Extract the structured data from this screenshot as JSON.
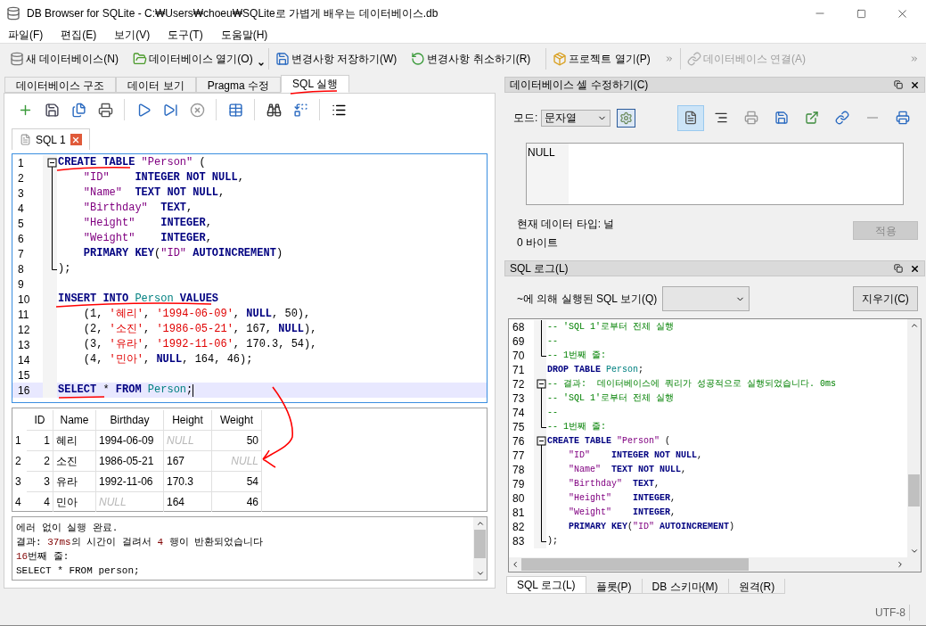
{
  "window": {
    "title": "DB Browser for SQLite - C:₩Users₩choeu₩SQLite로 가볍게 배우는 데이터베이스.db"
  },
  "menu": [
    "파일(F)",
    "편집(E)",
    "보기(V)",
    "도구(T)",
    "도움말(H)"
  ],
  "toolbar": [
    {
      "label": "새 데이터베이스(N)",
      "kind": "new",
      "disabled": false
    },
    {
      "label": "데이터베이스 열기(O)",
      "kind": "open",
      "disabled": false
    },
    {
      "label": "변경사항 저장하기(W)",
      "kind": "save",
      "disabled": false
    },
    {
      "label": "변경사항 취소하기(R)",
      "kind": "revert",
      "disabled": false
    },
    {
      "label": "프로젝트 열기(P)",
      "kind": "project",
      "disabled": false
    },
    {
      "label": "데이터베이스 연결(A)",
      "kind": "attach",
      "disabled": true
    }
  ],
  "tabs": [
    {
      "label": "데이터베이스 구조",
      "selected": false
    },
    {
      "label": "데이터 보기",
      "selected": false
    },
    {
      "label": "Pragma 수정",
      "selected": false
    },
    {
      "label": "SQL 실행",
      "selected": true
    }
  ],
  "editor": {
    "tab": "SQL 1",
    "lines": [
      {
        "number": "1",
        "kind": "fold_start",
        "current": false,
        "tokens": [
          {
            "kind": "keyword",
            "text": "CREATE TABLE"
          },
          {
            "kind": "string",
            "text": " \"Person\""
          },
          {
            "kind": "plain",
            "text": " ("
          }
        ]
      },
      {
        "number": "2",
        "kind": "fold_body",
        "current": false,
        "tokens": [
          {
            "kind": "string",
            "text": "    \"ID\""
          },
          {
            "kind": "keyword",
            "text": "    INTEGER NOT NULL"
          },
          {
            "kind": "plain",
            "text": ","
          }
        ]
      },
      {
        "number": "3",
        "kind": "fold_body",
        "current": false,
        "tokens": [
          {
            "kind": "string",
            "text": "    \"Name\""
          },
          {
            "kind": "keyword",
            "text": "  TEXT NOT NULL"
          },
          {
            "kind": "plain",
            "text": ","
          }
        ]
      },
      {
        "number": "4",
        "kind": "fold_body",
        "current": false,
        "tokens": [
          {
            "kind": "string",
            "text": "    \"Birthday\""
          },
          {
            "kind": "keyword",
            "text": "  TEXT"
          },
          {
            "kind": "plain",
            "text": ","
          }
        ]
      },
      {
        "number": "5",
        "kind": "fold_body",
        "current": false,
        "tokens": [
          {
            "kind": "string",
            "text": "    \"Height\""
          },
          {
            "kind": "keyword",
            "text": "    INTEGER"
          },
          {
            "kind": "plain",
            "text": ","
          }
        ]
      },
      {
        "number": "6",
        "kind": "fold_body",
        "current": false,
        "tokens": [
          {
            "kind": "string",
            "text": "    \"Weight\""
          },
          {
            "kind": "keyword",
            "text": "    INTEGER"
          },
          {
            "kind": "plain",
            "text": ","
          }
        ]
      },
      {
        "number": "7",
        "kind": "fold_body",
        "current": false,
        "tokens": [
          {
            "kind": "keyword",
            "text": "    PRIMARY KEY"
          },
          {
            "kind": "plain",
            "text": "("
          },
          {
            "kind": "string",
            "text": "\"ID\""
          },
          {
            "kind": "keyword",
            "text": " AUTOINCREMENT"
          },
          {
            "kind": "plain",
            "text": ")"
          }
        ]
      },
      {
        "number": "8",
        "kind": "fold_end",
        "current": false,
        "tokens": [
          {
            "kind": "plain",
            "text": ");"
          }
        ]
      },
      {
        "number": "9",
        "kind": "code",
        "current": false
      },
      {
        "number": "10",
        "kind": "code",
        "current": false,
        "tokens": [
          {
            "kind": "keyword",
            "text": "INSERT INTO"
          },
          {
            "kind": "identifier",
            "text": " Person"
          },
          {
            "kind": "keyword",
            "text": " VALUES"
          }
        ]
      },
      {
        "number": "11",
        "kind": "code",
        "current": false,
        "tokens": [
          {
            "kind": "plain",
            "text": "    (1, "
          },
          {
            "kind": "literal",
            "text": "'혜리'"
          },
          {
            "kind": "plain",
            "text": ", "
          },
          {
            "kind": "literal",
            "text": "'1994-06-09'"
          },
          {
            "kind": "plain",
            "text": ", "
          },
          {
            "kind": "keyword",
            "text": "NULL"
          },
          {
            "kind": "plain",
            "text": ", 50),"
          }
        ]
      },
      {
        "number": "12",
        "kind": "code",
        "current": false,
        "tokens": [
          {
            "kind": "plain",
            "text": "    (2, "
          },
          {
            "kind": "literal",
            "text": "'소진'"
          },
          {
            "kind": "plain",
            "text": ", "
          },
          {
            "kind": "literal",
            "text": "'1986-05-21'"
          },
          {
            "kind": "plain",
            "text": ", 167, "
          },
          {
            "kind": "keyword",
            "text": "NULL"
          },
          {
            "kind": "plain",
            "text": "),"
          }
        ]
      },
      {
        "number": "13",
        "kind": "code",
        "current": false,
        "tokens": [
          {
            "kind": "plain",
            "text": "    (3, "
          },
          {
            "kind": "literal",
            "text": "'유라'"
          },
          {
            "kind": "plain",
            "text": ", "
          },
          {
            "kind": "literal",
            "text": "'1992-11-06'"
          },
          {
            "kind": "plain",
            "text": ", 170.3, 54),"
          }
        ]
      },
      {
        "number": "14",
        "kind": "code",
        "current": false,
        "tokens": [
          {
            "kind": "plain",
            "text": "    (4, "
          },
          {
            "kind": "literal",
            "text": "'민아'"
          },
          {
            "kind": "plain",
            "text": ", "
          },
          {
            "kind": "keyword",
            "text": "NULL"
          },
          {
            "kind": "plain",
            "text": ", 164, 46);"
          }
        ]
      },
      {
        "number": "15",
        "kind": "code",
        "current": false
      },
      {
        "number": "16",
        "kind": "code",
        "current": true,
        "tokens": [
          {
            "kind": "keyword",
            "text": "SELECT"
          },
          {
            "kind": "plain",
            "text": " * "
          },
          {
            "kind": "keyword",
            "text": "FROM"
          },
          {
            "kind": "identifier",
            "text": " Person"
          },
          {
            "kind": "plain",
            "text": ";"
          }
        ]
      }
    ]
  },
  "results": {
    "columns": [
      "ID",
      "Name",
      "Birthday",
      "Height",
      "Weight"
    ],
    "rows": [
      {
        "header": "1",
        "cells": [
          {
            "text": "1",
            "kind": "number"
          },
          {
            "text": "혜리",
            "kind": "text"
          },
          {
            "text": "1994-06-09",
            "kind": "text"
          },
          {
            "text": "NULL",
            "kind": "null"
          },
          {
            "text": "50",
            "kind": "number"
          }
        ]
      },
      {
        "header": "2",
        "cells": [
          {
            "text": "2",
            "kind": "number"
          },
          {
            "text": "소진",
            "kind": "text"
          },
          {
            "text": "1986-05-21",
            "kind": "text"
          },
          {
            "text": "167",
            "kind": "text"
          },
          {
            "text": "NULL",
            "kind": "nullnum"
          }
        ]
      },
      {
        "header": "3",
        "cells": [
          {
            "text": "3",
            "kind": "number"
          },
          {
            "text": "유라",
            "kind": "text"
          },
          {
            "text": "1992-11-06",
            "kind": "text"
          },
          {
            "text": "170.3",
            "kind": "text"
          },
          {
            "text": "54",
            "kind": "number"
          }
        ]
      },
      {
        "header": "4",
        "cells": [
          {
            "text": "4",
            "kind": "number"
          },
          {
            "text": "민아",
            "kind": "text"
          },
          {
            "text": "NULL",
            "kind": "null"
          },
          {
            "text": "164",
            "kind": "text"
          },
          {
            "text": "46",
            "kind": "number"
          }
        ]
      }
    ]
  },
  "messages": [
    [
      {
        "kind": "plain",
        "text": "에러 없이 실행 완료."
      }
    ],
    [
      {
        "kind": "plain",
        "text": "결과: "
      },
      {
        "kind": "number",
        "text": "37ms"
      },
      {
        "kind": "plain",
        "text": "의 시간이 걸려서 "
      },
      {
        "kind": "number",
        "text": "4"
      },
      {
        "kind": "plain",
        "text": " 행이 반환되었습니다"
      }
    ],
    [
      {
        "kind": "number",
        "text": "16"
      },
      {
        "kind": "plain",
        "text": "번째 줄:"
      }
    ],
    [
      {
        "kind": "plain",
        "text": "SELECT * FROM person;"
      }
    ]
  ],
  "cell_editor": {
    "title": "데이터베이스 셀 수정하기(C)",
    "mode_label": "모드:",
    "mode_value": "문자열",
    "value": "NULL",
    "type_info": "현재 데이터 타입: 널",
    "size_info": "0 바이트",
    "apply": {
      "label": "적용",
      "disabled": true
    },
    "tools": [
      {
        "kind": "text",
        "selected": true
      },
      {
        "kind": "indent",
        "selected": false
      },
      {
        "kind": "print-grey",
        "selected": false
      },
      {
        "kind": "save",
        "selected": false
      },
      {
        "kind": "export",
        "selected": false
      },
      {
        "kind": "link",
        "selected": false
      },
      {
        "kind": "null",
        "selected": false
      },
      {
        "kind": "print",
        "selected": false
      }
    ]
  },
  "sql_log": {
    "title": "SQL 로그(L)",
    "filter_label": "~에 의해 실행된 SQL 보기(Q)",
    "clear_button": "지우기(C)",
    "lines": [
      {
        "number": "68",
        "kind": "fold_body",
        "tokens": [
          {
            "kind": "comment",
            "text": "-- 'SQL 1'로부터 전체 실행"
          }
        ]
      },
      {
        "number": "69",
        "kind": "fold_body",
        "tokens": [
          {
            "kind": "comment",
            "text": "--"
          }
        ]
      },
      {
        "number": "70",
        "kind": "fold_end",
        "tokens": [
          {
            "kind": "comment",
            "text": "-- 1번째 줄:"
          }
        ]
      },
      {
        "number": "71",
        "kind": "code",
        "tokens": [
          {
            "kind": "keyword",
            "text": "DROP TABLE"
          },
          {
            "kind": "identifier",
            "text": " Person"
          },
          {
            "kind": "plain",
            "text": ";"
          }
        ]
      },
      {
        "number": "72",
        "kind": "fold_start",
        "tokens": [
          {
            "kind": "comment",
            "text": "-- 결과:  데이터베이스에 쿼리가 성공적으로 실행되었습니다. 0ms"
          }
        ]
      },
      {
        "number": "73",
        "kind": "fold_body",
        "tokens": [
          {
            "kind": "comment",
            "text": "-- 'SQL 1'로부터 전체 실행"
          }
        ]
      },
      {
        "number": "74",
        "kind": "fold_body",
        "tokens": [
          {
            "kind": "comment",
            "text": "--"
          }
        ]
      },
      {
        "number": "75",
        "kind": "fold_end",
        "tokens": [
          {
            "kind": "comment",
            "text": "-- 1번째 줄:"
          }
        ]
      },
      {
        "number": "76",
        "kind": "fold_start",
        "tokens": [
          {
            "kind": "keyword",
            "text": "CREATE TABLE"
          },
          {
            "kind": "string",
            "text": " \"Person\""
          },
          {
            "kind": "plain",
            "text": " ("
          }
        ]
      },
      {
        "number": "77",
        "kind": "fold_body",
        "tokens": [
          {
            "kind": "string",
            "text": "    \"ID\""
          },
          {
            "kind": "keyword",
            "text": "    INTEGER NOT NULL"
          },
          {
            "kind": "plain",
            "text": ","
          }
        ]
      },
      {
        "number": "78",
        "kind": "fold_body",
        "tokens": [
          {
            "kind": "string",
            "text": "    \"Name\""
          },
          {
            "kind": "keyword",
            "text": "  TEXT NOT NULL"
          },
          {
            "kind": "plain",
            "text": ","
          }
        ]
      },
      {
        "number": "79",
        "kind": "fold_body",
        "tokens": [
          {
            "kind": "string",
            "text": "    \"Birthday\""
          },
          {
            "kind": "keyword",
            "text": "  TEXT"
          },
          {
            "kind": "plain",
            "text": ","
          }
        ]
      },
      {
        "number": "80",
        "kind": "fold_body",
        "tokens": [
          {
            "kind": "string",
            "text": "    \"Height\""
          },
          {
            "kind": "keyword",
            "text": "    INTEGER"
          },
          {
            "kind": "plain",
            "text": ","
          }
        ]
      },
      {
        "number": "81",
        "kind": "fold_body",
        "tokens": [
          {
            "kind": "string",
            "text": "    \"Weight\""
          },
          {
            "kind": "keyword",
            "text": "    INTEGER"
          },
          {
            "kind": "plain",
            "text": ","
          }
        ]
      },
      {
        "number": "82",
        "kind": "fold_body",
        "tokens": [
          {
            "kind": "keyword",
            "text": "    PRIMARY KEY"
          },
          {
            "kind": "plain",
            "text": "("
          },
          {
            "kind": "string",
            "text": "\"ID\""
          },
          {
            "kind": "keyword",
            "text": " AUTOINCREMENT"
          },
          {
            "kind": "plain",
            "text": ")"
          }
        ]
      },
      {
        "number": "83",
        "kind": "fold_end",
        "tokens": [
          {
            "kind": "plain",
            "text": ");"
          }
        ]
      }
    ]
  },
  "bottom_tabs": [
    {
      "label": "SQL 로그(L)",
      "selected": true
    },
    {
      "label": "플롯(P)",
      "selected": false
    },
    {
      "label": "DB 스키마(M)",
      "selected": false
    },
    {
      "label": "원격(R)",
      "selected": false
    }
  ],
  "status_bar": {
    "encoding": "UTF-8"
  }
}
